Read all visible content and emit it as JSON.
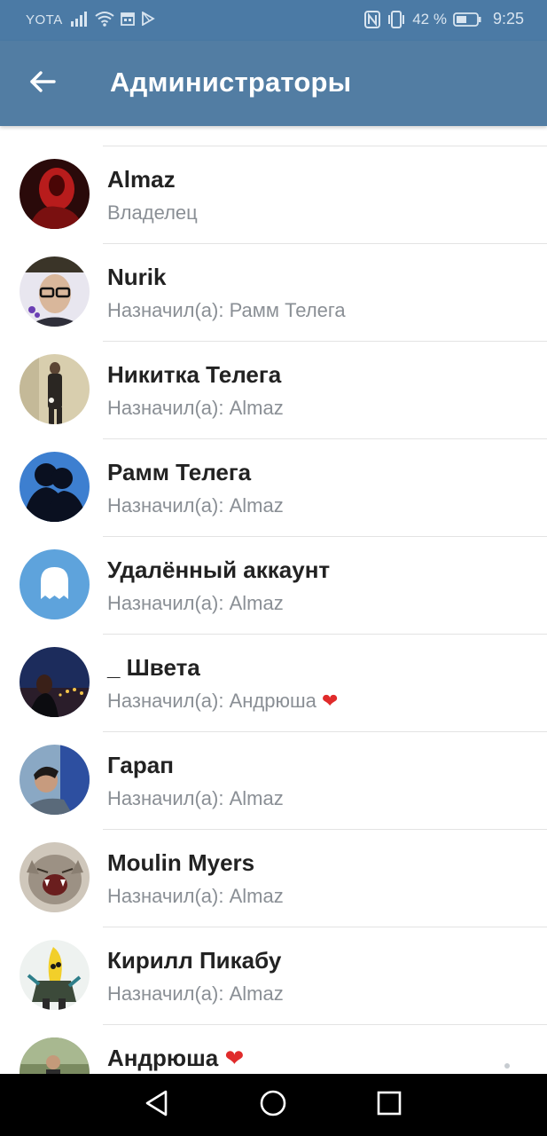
{
  "status_bar": {
    "carrier": "YOTA",
    "battery_percent": "42 %",
    "time": "9:25"
  },
  "header": {
    "title": "Администраторы"
  },
  "admins": [
    {
      "name": "Almaz",
      "subtitle": "Владелец"
    },
    {
      "name": "Nurik",
      "subtitle": "Назначил(а): Рамм Телега"
    },
    {
      "name": "Никитка Телега",
      "subtitle": "Назначил(а): Almaz"
    },
    {
      "name": "Рамм Телега",
      "subtitle": "Назначил(а): Almaz"
    },
    {
      "name": "Удалённый аккаунт",
      "subtitle": "Назначил(а): Almaz"
    },
    {
      "name": "_ Швета",
      "subtitle": "Назначил(а): Андрюша ❤️"
    },
    {
      "name": "Гарап",
      "subtitle": "Назначил(а): Almaz"
    },
    {
      "name": "Moulin Myers",
      "subtitle": "Назначил(а): Almaz"
    },
    {
      "name": "Кирилл Пикабу",
      "subtitle": "Назначил(а): Almaz"
    },
    {
      "name": "Андрюша ❤️",
      "subtitle": ""
    }
  ],
  "colors": {
    "status_bar": "#4b7aa5",
    "app_bar": "#527da3",
    "name_text": "#222222",
    "subtitle_text": "#8a8f95",
    "divider": "#e3e3e3",
    "ghost_avatar_bg": "#5ea3dc"
  },
  "icons": {
    "back": "arrow-left-icon",
    "nav_back": "triangle-back-icon",
    "nav_home": "circle-home-icon",
    "nav_recents": "square-recents-icon"
  }
}
